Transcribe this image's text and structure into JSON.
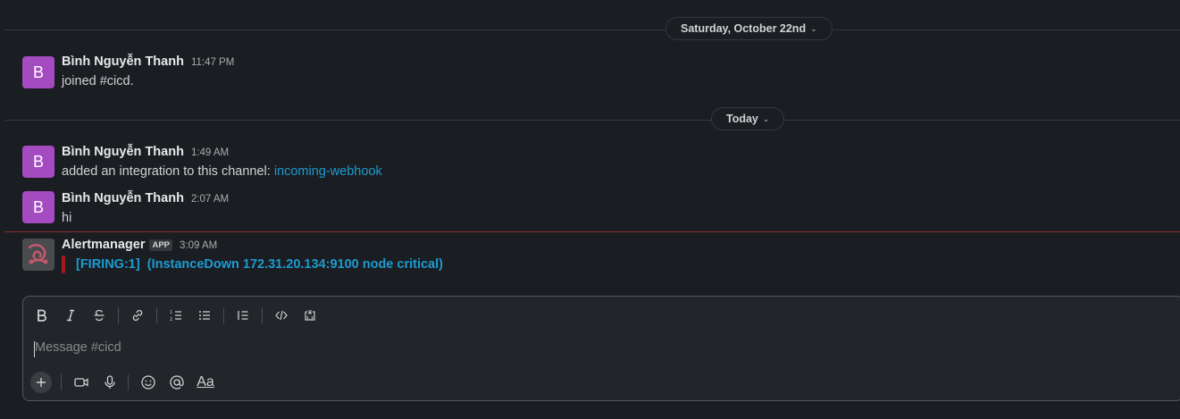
{
  "dividers": [
    {
      "label": "Saturday, October 22nd",
      "chevron": "chevron-down-icon"
    },
    {
      "label": "Today",
      "chevron": "chevron-down-icon"
    }
  ],
  "messages": [
    {
      "avatar": "B",
      "sender": "Bình Nguyễn Thanh",
      "time": "11:47 PM",
      "text": "joined #cicd."
    },
    {
      "avatar": "B",
      "sender": "Bình Nguyễn Thanh",
      "time": "1:49 AM",
      "text": "added an integration to this channel: ",
      "link": "incoming-webhook"
    },
    {
      "avatar": "B",
      "sender": "Bình Nguyễn Thanh",
      "time": "2:07 AM",
      "text": "hi"
    },
    {
      "avatar_icon": "alertmanager-logo",
      "sender": "Alertmanager",
      "badge": "APP",
      "time": "3:09 AM",
      "attachment": {
        "title": "[FIRING:1]  (InstanceDown 172.31.20.134:9100 node critical)",
        "color": "#a31b1b"
      }
    }
  ],
  "composer": {
    "placeholder": "Message #cicd",
    "format_icons": [
      "bold-icon",
      "italic-icon",
      "strikethrough-icon",
      "link-icon",
      "numbered-list-icon",
      "bulleted-list-icon",
      "blockquote-icon",
      "code-icon",
      "code-block-icon"
    ],
    "action_icons": [
      "plus-icon",
      "video-icon",
      "microphone-icon",
      "emoji-icon",
      "mention-icon",
      "formatting-icon"
    ],
    "formatting_label": "Aa"
  },
  "colors": {
    "background": "#1a1d21",
    "link": "#1d9bd1",
    "avatar": "#a54bc2",
    "new_divider": "#8b2f2f"
  }
}
